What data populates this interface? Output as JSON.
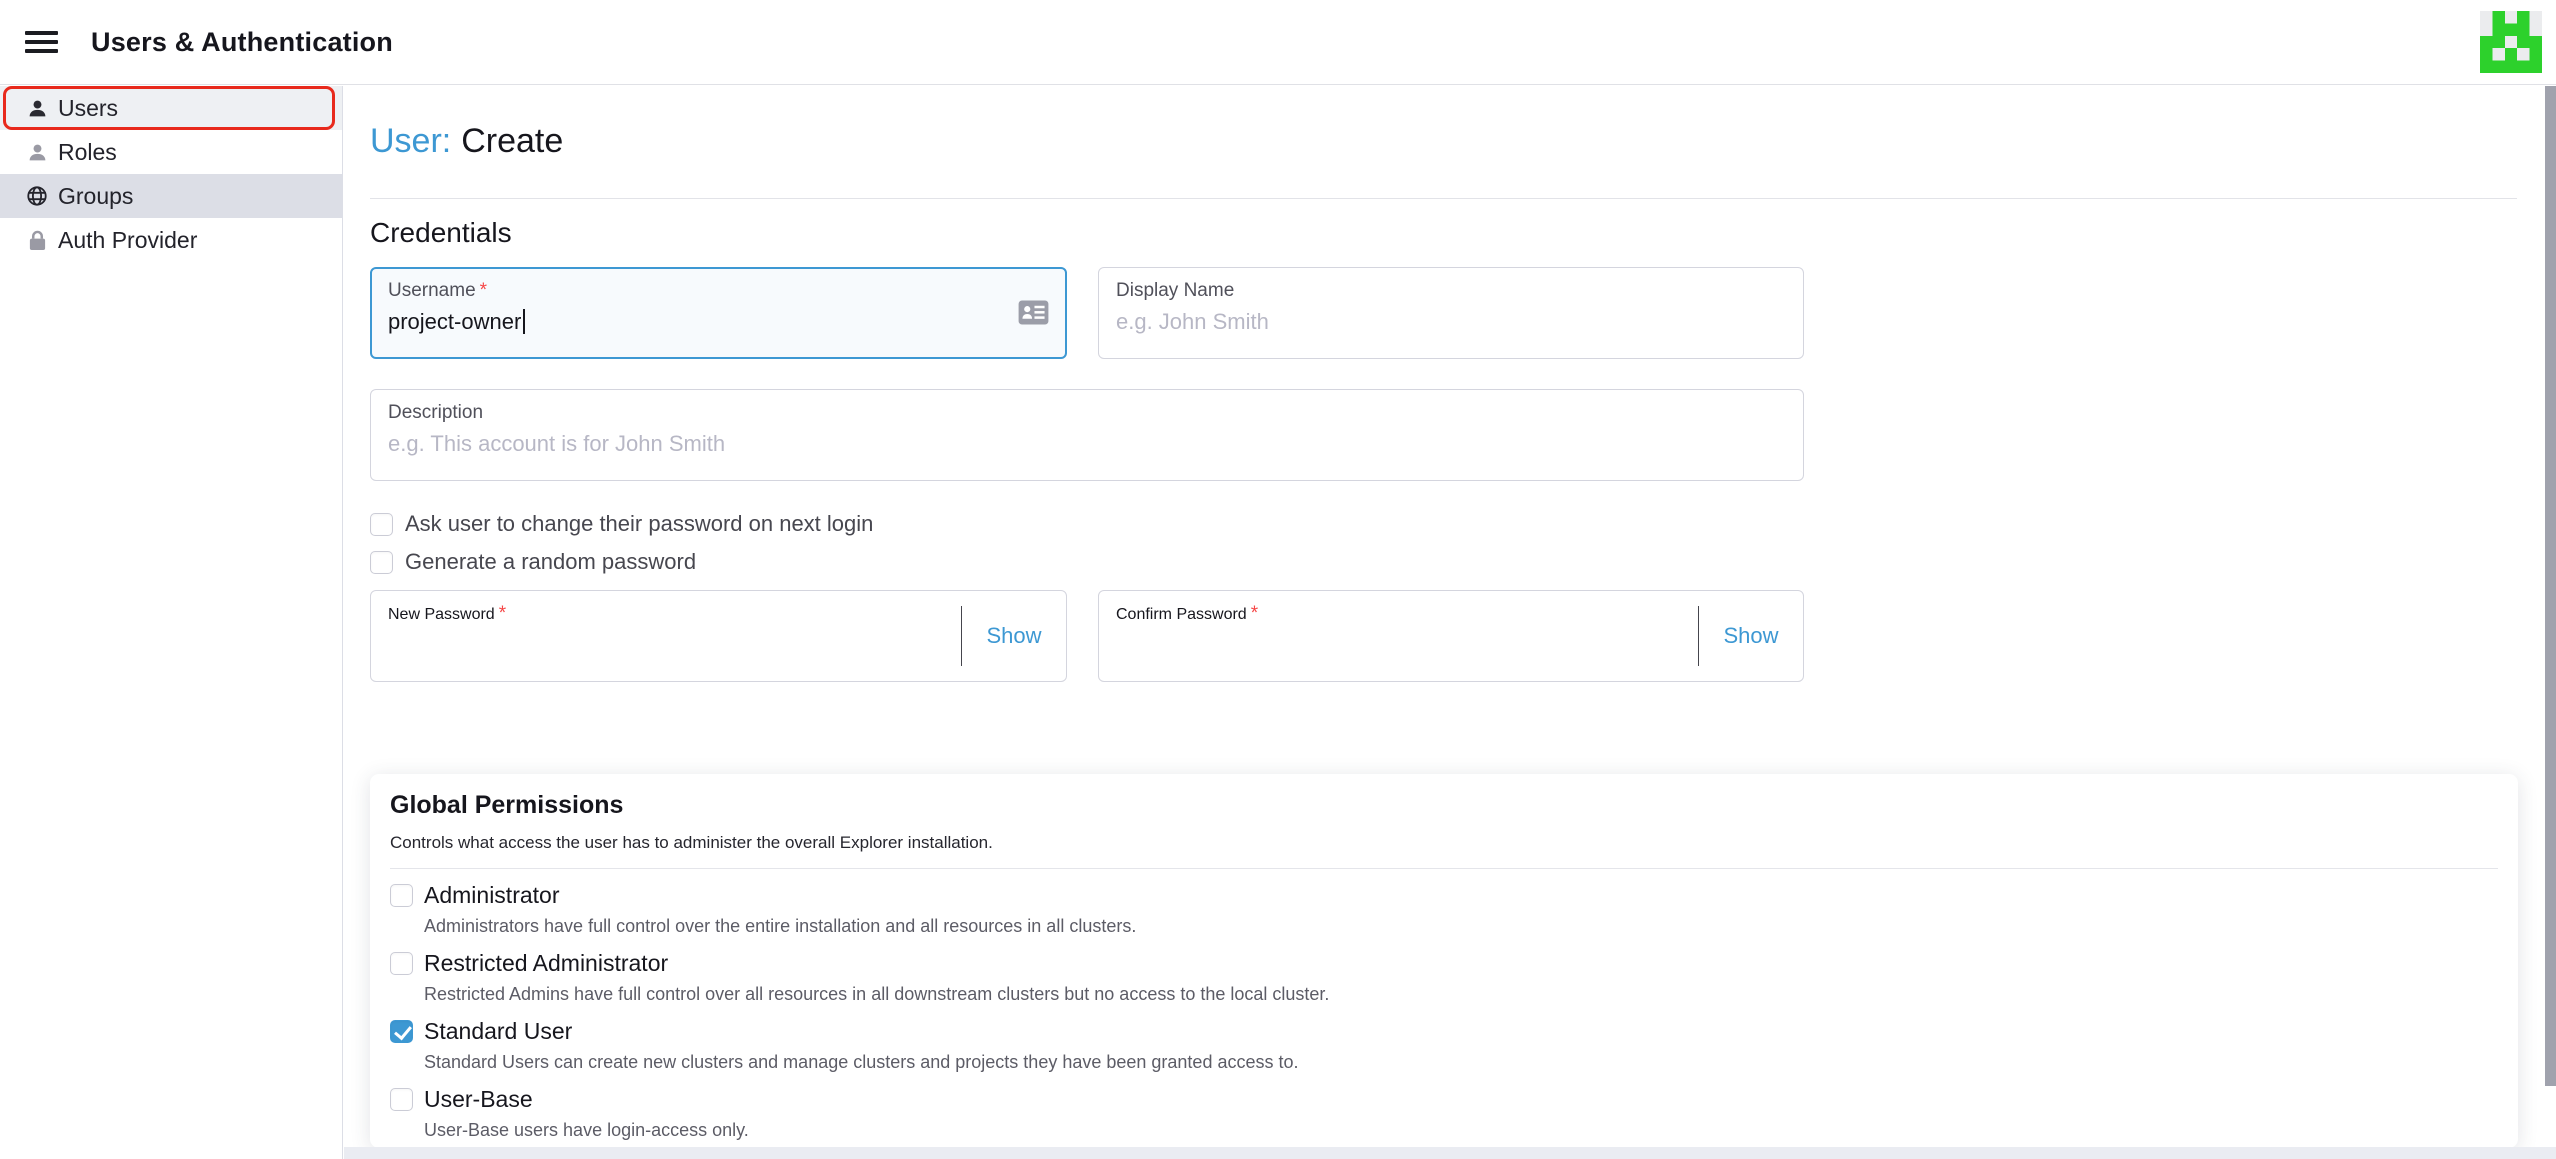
{
  "header": {
    "title": "Users & Authentication"
  },
  "sidebar": {
    "items": [
      {
        "label": "Users",
        "icon": "user-icon",
        "state": "selected-annotated"
      },
      {
        "label": "Roles",
        "icon": "user-icon",
        "state": "normal"
      },
      {
        "label": "Groups",
        "icon": "globe-icon",
        "state": "active"
      },
      {
        "label": "Auth Provider",
        "icon": "lock-icon",
        "state": "normal"
      }
    ]
  },
  "page": {
    "title_prefix": "User:",
    "title": "Create",
    "required_mark": "*",
    "credentials": {
      "heading": "Credentials",
      "username": {
        "label": "Username",
        "value": "project-owner",
        "required": true,
        "icon": "address-card-icon",
        "focused": true
      },
      "display_name": {
        "label": "Display Name",
        "placeholder": "e.g. John Smith"
      },
      "description": {
        "label": "Description",
        "placeholder": "e.g. This account is for John Smith"
      },
      "ask_change_password": {
        "label": "Ask user to change their password on next login",
        "checked": false
      },
      "generate_random_password": {
        "label": "Generate a random password",
        "checked": false
      },
      "new_password": {
        "label": "New Password",
        "required": true,
        "show_label": "Show",
        "value": ""
      },
      "confirm_password": {
        "label": "Confirm Password",
        "required": true,
        "show_label": "Show",
        "value": ""
      }
    },
    "global_permissions": {
      "heading": "Global Permissions",
      "subheading": "Controls what access the user has to administer the overall Explorer installation.",
      "options": [
        {
          "label": "Administrator",
          "checked": false,
          "description": "Administrators have full control over the entire installation and all resources in all clusters."
        },
        {
          "label": "Restricted Administrator",
          "checked": false,
          "description": "Restricted Admins have full control over all resources in all downstream clusters but no access to the local cluster."
        },
        {
          "label": "Standard User",
          "checked": true,
          "description": "Standard Users can create new clusters and manage clusters and projects they have been granted access to."
        },
        {
          "label": "User-Base",
          "checked": false,
          "description": "User-Base users have login-access only."
        }
      ]
    }
  },
  "colors": {
    "primary_blue": "#3d98d3",
    "required_red": "#f64747",
    "annotation_red": "#e8291c",
    "logo_green": "#2dd12c",
    "active_nav_bg": "#dcdee6",
    "selected_nav_bg": "#eef0f3"
  }
}
